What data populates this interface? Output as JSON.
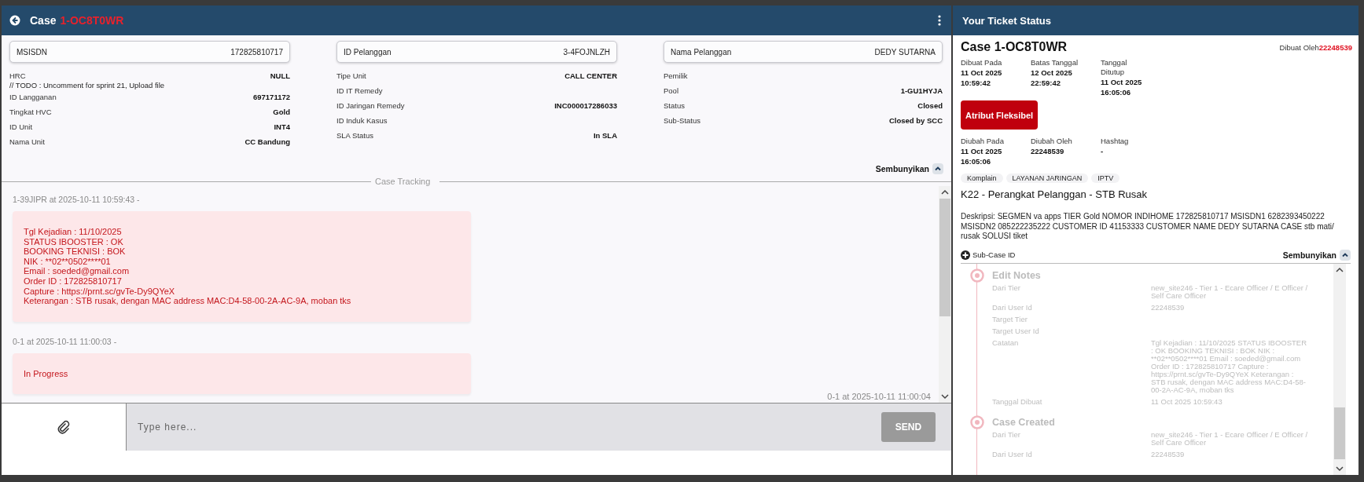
{
  "header": {
    "title": "Case",
    "case_id": "1-OC8T0WR"
  },
  "info_columns": [
    {
      "card": {
        "label": "MSISDN",
        "value": "172825810717"
      },
      "rows": [
        {
          "kind": "field",
          "label": "HRC",
          "value": "NULL"
        },
        {
          "kind": "note",
          "label": "// TODO : Uncomment for sprint 21, Upload file"
        },
        {
          "kind": "field",
          "label": "ID Langganan",
          "value": "697171172"
        },
        {
          "kind": "field",
          "label": "Tingkat HVC",
          "value": "Gold"
        },
        {
          "kind": "field",
          "label": "ID Unit",
          "value": "INT4"
        },
        {
          "kind": "field",
          "label": "Nama Unit",
          "value": "CC Bandung"
        }
      ]
    },
    {
      "card": {
        "label": "ID Pelanggan",
        "value": "3-4FOJNLZH"
      },
      "rows": [
        {
          "kind": "field",
          "label": "Tipe Unit",
          "value": "CALL CENTER"
        },
        {
          "kind": "field",
          "label": "ID IT Remedy"
        },
        {
          "kind": "field",
          "label": "ID Jaringan Remedy",
          "value": "INC000017286033"
        },
        {
          "kind": "field",
          "label": "ID Induk Kasus"
        },
        {
          "kind": "field",
          "label": "SLA Status",
          "value": "In SLA"
        }
      ]
    },
    {
      "card": {
        "label": "Nama Pelanggan",
        "value": "DEDY SUTARNA"
      },
      "rows": [
        {
          "kind": "field",
          "label": "Pemilik"
        },
        {
          "kind": "field",
          "label": "Pool",
          "value": "1-GU1HYJA"
        },
        {
          "kind": "field",
          "label": "Status",
          "value": "Closed"
        },
        {
          "kind": "field",
          "label": "Sub-Status",
          "value": "Closed by SCC"
        }
      ]
    }
  ],
  "info_toggle": {
    "label": "Sembunyikan"
  },
  "case_tracking": {
    "title": "Case Tracking",
    "messages": [
      {
        "meta": "1-39JIPR at 2025-10-11 10:59:43 -",
        "lines": [
          "Tgl Kejadian : 11/10/2025",
          "STATUS IBOOSTER : OK",
          "BOOKING TEKNISI : BOK",
          "NIK : **02**0502****01",
          "Email : soeded@gmail.com",
          "Order ID : 172825810717",
          "Capture : https://prnt.sc/gvTe-Dy9QYeX",
          "Keterangan : STB rusak, dengan MAC address MAC:D4-58-00-2A-AC-9A, moban tks"
        ]
      },
      {
        "meta": "0-1 at 2025-10-11 11:00:03 -",
        "lines": [
          "In Progress"
        ]
      }
    ],
    "last_timestamp": "0-1 at 2025-10-11 11:00:04"
  },
  "composer": {
    "placeholder": "Type here...",
    "send_label": "SEND"
  },
  "ticket": {
    "title": "Your Ticket Status",
    "case_title": "Case 1-OC8T0WR",
    "created_by_label": "Dibuat Oleh",
    "created_by": "22248539",
    "dates": [
      {
        "label": "Dibuat Pada",
        "value": "11 Oct 2025 10:59:42"
      },
      {
        "label": "Batas Tanggal",
        "value": "12 Oct 2025 22:59:42"
      },
      {
        "label": "Tanggal Ditutup",
        "value": "11 Oct 2025 16:05:06"
      }
    ],
    "button": "Atribut Fleksibel",
    "changes": [
      {
        "label": "Diubah Pada",
        "value": "11 Oct 2025 16:05:06"
      },
      {
        "label": "Diubah Oleh",
        "value": "22248539"
      },
      {
        "label": "Hashtag",
        "value": "-"
      }
    ],
    "tags": [
      "Komplain",
      "LAYANAN JARINGAN",
      "IPTV"
    ],
    "category": "K22 - Perangkat Pelanggan - STB Rusak",
    "description": "Deskripsi: SEGMEN va apps TIER Gold NOMOR INDIHOME 172825810717 MSISDN1 6282393450222 MSISDN2 085222235222 CUSTOMER ID 41153333 CUSTOMER NAME DEDY SUTARNA CASE stb mati/ rusak SOLUSI tiket",
    "subcase": {
      "label": "Sub-Case ID",
      "toggle": "Sembunyikan"
    },
    "timeline": [
      {
        "title": "Edit Notes",
        "fields": [
          {
            "label": "Dari Tier",
            "value": "new_site246 - Tier 1 - Ecare Officer / E Officer / Self Care Officer"
          },
          {
            "label": "Dari User Id",
            "value": "22248539"
          },
          {
            "label": "Target Tier"
          },
          {
            "label": "Target User Id"
          },
          {
            "label": "Catatan",
            "value": "Tgl Kejadian : 11/10/2025 STATUS IBOOSTER : OK BOOKING TEKNISI : BOK NIK : **02**0502****01 Email : soeded@gmail.com Order ID : 172825810717 Capture : https://prnt.sc/gvTe-Dy9QYeX Keterangan : STB rusak, dengan MAC address MAC:D4-58-00-2A-AC-9A, moban tks"
          },
          {
            "label": "Tanggal Dibuat",
            "value": "11 Oct 2025 10:59:43"
          }
        ]
      },
      {
        "title": "Case Created",
        "fields": [
          {
            "label": "Dari Tier",
            "value": "new_site246 - Tier 1 - Ecare Officer / E Officer / Self Care Officer"
          },
          {
            "label": "Dari User Id",
            "value": "22248539"
          }
        ]
      }
    ]
  }
}
